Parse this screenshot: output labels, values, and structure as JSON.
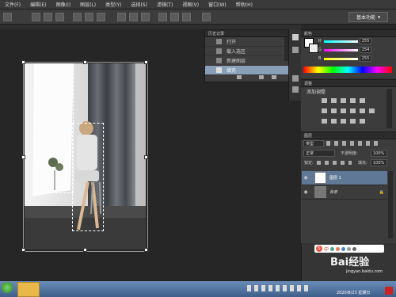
{
  "menu": [
    "文件(F)",
    "编辑(E)",
    "图像(I)",
    "图层(L)",
    "类型(Y)",
    "选择(S)",
    "滤镜(T)",
    "视图(V)",
    "窗口(W)",
    "帮助(H)"
  ],
  "workspace": {
    "label": "基本功能",
    "arrow": "▼"
  },
  "history": {
    "title": "历史记录",
    "items": [
      {
        "label": "打开",
        "active": false
      },
      {
        "label": "载入选区",
        "active": false
      },
      {
        "label": "新建图层",
        "active": false
      },
      {
        "label": "填充",
        "active": true
      }
    ]
  },
  "color_panel": {
    "tab": "颜色",
    "channels": [
      {
        "name": "R",
        "value": "255"
      },
      {
        "name": "G",
        "value": "254"
      },
      {
        "name": "B",
        "value": "255"
      }
    ]
  },
  "adjustments": {
    "tab": "调整",
    "title": "添加调整"
  },
  "layers": {
    "tab": "图层",
    "filter": "类型",
    "blend_mode": "正常",
    "opacity_label": "不透明度:",
    "opacity": "100%",
    "lock_label": "锁定:",
    "fill_label": "填充:",
    "fill": "100%",
    "items": [
      {
        "name": "图层 1",
        "selected": true
      },
      {
        "name": "背景",
        "selected": false
      }
    ]
  },
  "ime": {
    "logo": "S",
    "mode": "中"
  },
  "watermark": {
    "brand": "Bai经验",
    "url": "jingyan.baidu.com"
  },
  "taskbar": {
    "date": "2020/8/23 星期日"
  }
}
